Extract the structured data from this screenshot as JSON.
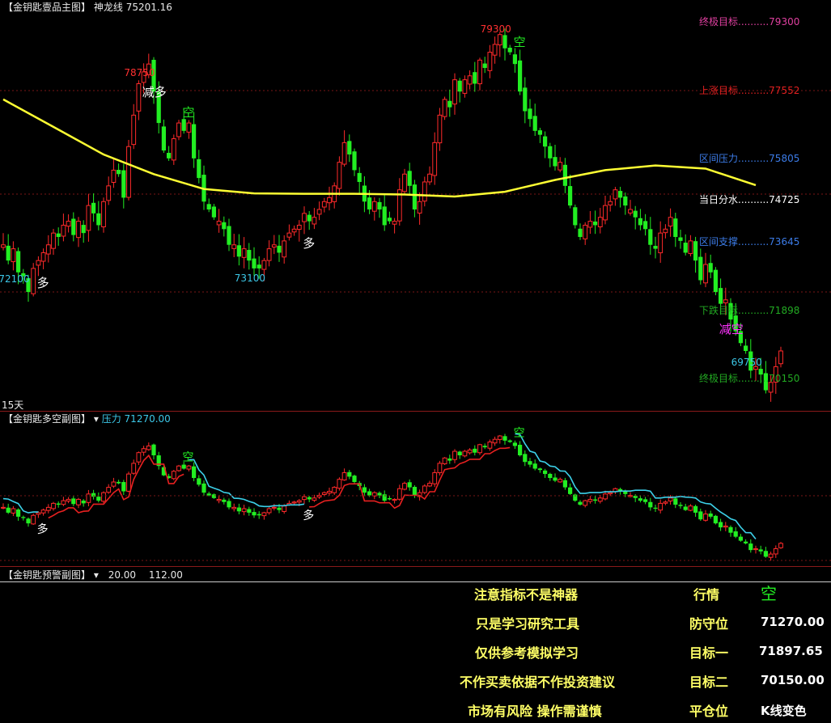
{
  "colors": {
    "up": "#ff2a2a",
    "down": "#22ee22",
    "ma": "#ffff33",
    "resist": "#3cd0e8",
    "support": "#e82020",
    "grid": "#7a1616",
    "white": "#ffffff",
    "yellow": "#ffff66",
    "cyan": "#3cc8e8"
  },
  "main": {
    "panel_name": "【金钥匙壹品主图】",
    "indicator_name": "神龙线",
    "indicator_value": "75201.16",
    "period_label": "15天",
    "levels": [
      {
        "name": "终极目标",
        "value": "79300",
        "color": "#e040a0"
      },
      {
        "name": "上涨目标",
        "value": "77552",
        "color": "#e02020"
      },
      {
        "name": "区间压力",
        "value": "75805",
        "color": "#3c7ce8"
      },
      {
        "name": "当日分水",
        "value": "74725",
        "color": "#ffffff"
      },
      {
        "name": "区间支撑",
        "value": "73645",
        "color": "#3c7ce8"
      },
      {
        "name": "下跌目标",
        "value": "71898",
        "color": "#22aa22"
      },
      {
        "name": "终极目标",
        "value": "70150",
        "color": "#22aa22"
      }
    ],
    "price_marks": [
      {
        "text": "72100",
        "color": "#3cc8e8",
        "bar": 2
      },
      {
        "text": "78750",
        "color": "#ff3030",
        "bar": 27
      },
      {
        "text": "73100",
        "color": "#3cc8e8",
        "bar": 49
      },
      {
        "text": "79300",
        "color": "#ff3030",
        "bar": 98
      },
      {
        "text": "69750",
        "color": "#3cc8e8",
        "bar": 148
      }
    ],
    "signals": [
      {
        "text": "多",
        "color": "#ffffff",
        "bar": 8
      },
      {
        "text": "减多",
        "color": "#ffffff",
        "bar": 29
      },
      {
        "text": "空",
        "color": "#22ee22",
        "bar": 37
      },
      {
        "text": "多",
        "color": "#ffffff",
        "bar": 61
      },
      {
        "text": "空",
        "color": "#22ee22",
        "bar": 103
      },
      {
        "text": "减空",
        "color": "#ff33ff",
        "bar": 144
      }
    ]
  },
  "sub": {
    "panel_name": "【金钥匙多空副图】",
    "indicator_name": "压力",
    "indicator_value": "71270.00",
    "signals": [
      {
        "text": "多",
        "color": "#ffffff",
        "bar": 8
      },
      {
        "text": "空",
        "color": "#22ee22",
        "bar": 37
      },
      {
        "text": "多",
        "color": "#ffffff",
        "bar": 61
      },
      {
        "text": "空",
        "color": "#22ee22",
        "bar": 103
      }
    ]
  },
  "warn": {
    "panel_name": "【金钥匙预警副图】",
    "value1": "20.00",
    "value2": "112.00",
    "notes": [
      "注意指标不是神器",
      "只是学习研究工具",
      "仅供参考模拟学习",
      "不作买卖依据不作投资建议",
      "市场有风险 操作需谨慎"
    ],
    "table": [
      {
        "label": "行情",
        "value": "空",
        "value_color": "#22ee22"
      },
      {
        "label": "防守位",
        "value": "71270.00",
        "value_color": "#ffffff"
      },
      {
        "label": "目标一",
        "value": "71897.65",
        "value_color": "#ffffff"
      },
      {
        "label": "目标二",
        "value": "70150.00",
        "value_color": "#ffffff"
      },
      {
        "label": "平仓位",
        "value": "K线变色",
        "value_color": "#ffffff"
      }
    ]
  },
  "chart_data": [
    {
      "type": "candlestick",
      "title": "【金钥匙壹品主图】",
      "ylim": [
        69600,
        79600
      ],
      "series": [
        {
          "name": "神龙线",
          "points": [
            [
              0,
              77400
            ],
            [
              10,
              76700
            ],
            [
              20,
              76000
            ],
            [
              30,
              75500
            ],
            [
              40,
              75120
            ],
            [
              50,
              75010
            ],
            [
              60,
              75000
            ],
            [
              70,
              75000
            ],
            [
              80,
              74980
            ],
            [
              90,
              74930
            ],
            [
              100,
              75050
            ],
            [
              110,
              75350
            ],
            [
              120,
              75600
            ],
            [
              130,
              75720
            ],
            [
              140,
              75640
            ],
            [
              150,
              75220
            ]
          ]
        }
      ],
      "close_path": [
        73700,
        73300,
        73600,
        73000,
        72900,
        72500,
        73100,
        73300,
        73500,
        73700,
        74000,
        73900,
        74200,
        74300,
        73950,
        74300,
        74000,
        74700,
        74500,
        74200,
        74800,
        75200,
        75600,
        75500,
        74900,
        76200,
        77000,
        77800,
        78100,
        78300,
        77600,
        76800,
        76100,
        75900,
        76400,
        76800,
        76600,
        76800,
        75900,
        75400,
        74800,
        74600,
        74400,
        74300,
        74100,
        73700,
        73700,
        73400,
        73600,
        73300,
        73100,
        73100,
        73300,
        73600,
        73700,
        73500,
        73800,
        74000,
        74100,
        74200,
        74500,
        74300,
        74400,
        74600,
        74800,
        74900,
        75200,
        75800,
        76300,
        76000,
        75600,
        75300,
        74800,
        74600,
        74800,
        74600,
        74200,
        74300,
        74300,
        75100,
        75500,
        75200,
        74600,
        74800,
        75300,
        75500,
        76300,
        77000,
        77400,
        77200,
        77900,
        77600,
        77900,
        78000,
        77800,
        78400,
        78200,
        78600,
        78800,
        79050,
        78700,
        78600,
        78300,
        77600,
        77100,
        76900,
        76600,
        76500,
        76200,
        75900,
        75700,
        75800,
        75200,
        74700,
        74200,
        73900,
        74200,
        74300,
        74200,
        74400,
        74700,
        74800,
        75100,
        74900,
        74700,
        74600,
        74400,
        74200,
        74100,
        73700,
        73600,
        74000,
        74100,
        74400,
        73900,
        73800,
        73500,
        73800,
        73300,
        72800,
        73200,
        73000,
        72500,
        72200,
        72300,
        71800,
        71500,
        71200,
        71000,
        70500,
        70600,
        70400,
        70000,
        70200,
        70600,
        71000
      ]
    },
    {
      "type": "candlestick",
      "title": "【金钥匙多空副图】",
      "series": [
        {
          "name": "压力",
          "last": 71270.0
        }
      ]
    }
  ]
}
